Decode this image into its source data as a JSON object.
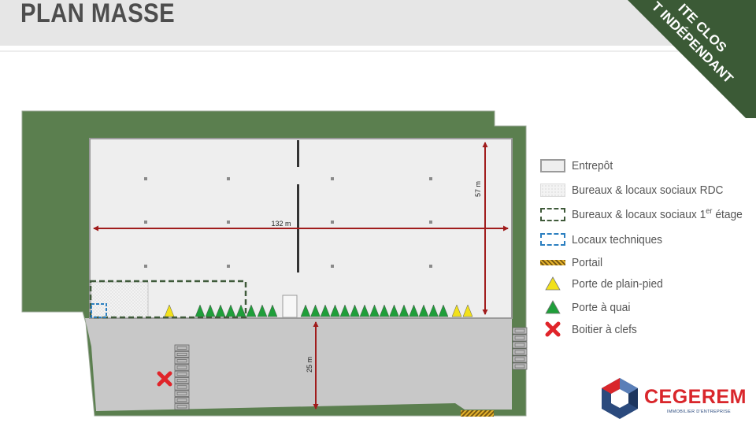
{
  "header": {
    "title": "PLAN MASSE",
    "corner_line1": "ITE CLOS",
    "corner_line2": "T INDÉPENDANT"
  },
  "plan": {
    "width_label": "132 m",
    "depth_label": "57 m",
    "yard_label": "25 m"
  },
  "legend": [
    {
      "icon": "warehouse-swatch",
      "label": "Entrepôt"
    },
    {
      "icon": "office-ground-swatch",
      "label": "Bureaux & locaux sociaux RDC"
    },
    {
      "icon": "office-first-floor-swatch",
      "label_main": "Bureaux & locaux sociaux 1",
      "label_sup": "er",
      "label_end": " étage"
    },
    {
      "icon": "technical-room-swatch",
      "label": "Locaux techniques"
    },
    {
      "icon": "gate-swatch",
      "label": "Portail"
    },
    {
      "icon": "yellow-triangle-icon",
      "label": "Porte de plain-pied"
    },
    {
      "icon": "green-triangle-icon",
      "label": "Porte à quai"
    },
    {
      "icon": "red-cross-icon",
      "label": "Boitier à clefs"
    }
  ],
  "colors": {
    "green": "#5b7f4f",
    "warehouse": "#eeeeee",
    "yard": "#c8c8c8",
    "dimension": "#a01c1c",
    "dock_door": "#1f9e3a",
    "ground_door": "#f2e11a",
    "key_box": "#e0242a",
    "tech_room": "#2b7fc0",
    "office_first_floor": "#3f5a3a",
    "corner_banner": "#3b5a36"
  },
  "logo": {
    "name": "CEGEREM",
    "subtitle": "IMMOBILIER D'ENTREPRISE"
  }
}
